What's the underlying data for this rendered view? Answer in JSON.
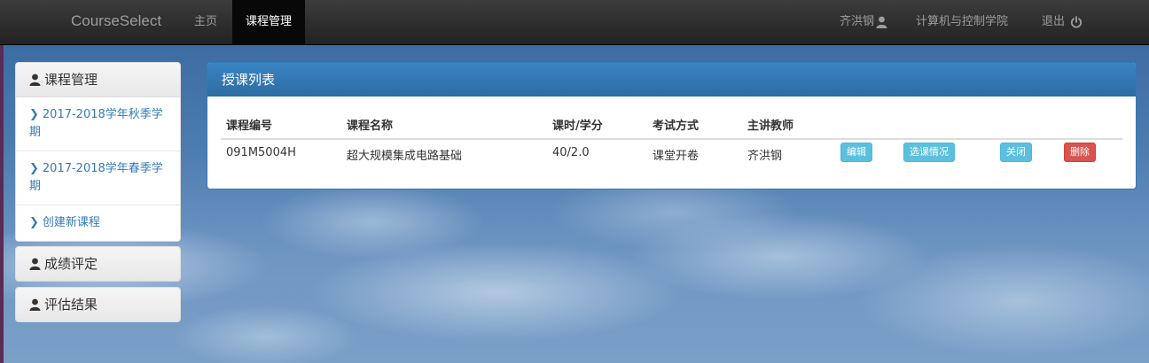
{
  "navbar": {
    "brand": "CourseSelect",
    "home": "主页",
    "course_mgmt": "课程管理",
    "user": "齐洪钢",
    "department": "计算机与控制学院",
    "logout": "退出"
  },
  "sidebar": {
    "course_header": "课程管理",
    "items": [
      {
        "label": "2017-2018学年秋季学期"
      },
      {
        "label": "2017-2018学年春季学期"
      },
      {
        "label": "创建新课程"
      }
    ],
    "grade_header": "成绩评定",
    "eval_header": "评估结果"
  },
  "main": {
    "title": "授课列表",
    "columns": [
      "课程编号",
      "课程名称",
      "课时/学分",
      "考试方式",
      "主讲教师"
    ],
    "rows": [
      {
        "code": "091M5004H",
        "name": "超大规模集成电路基础",
        "hours": "40/2.0",
        "exam": "课堂开卷",
        "teacher": "齐洪钢"
      }
    ],
    "actions": {
      "edit": "编辑",
      "enrollment": "选课情况",
      "close": "关闭",
      "delete": "删除"
    }
  },
  "icons": [
    "user-icon",
    "power-icon",
    "chevron-right-icon"
  ],
  "colors": {
    "primary": "#337ab7",
    "info": "#5bc0de",
    "danger": "#d9534f",
    "navbar": "#222222"
  }
}
